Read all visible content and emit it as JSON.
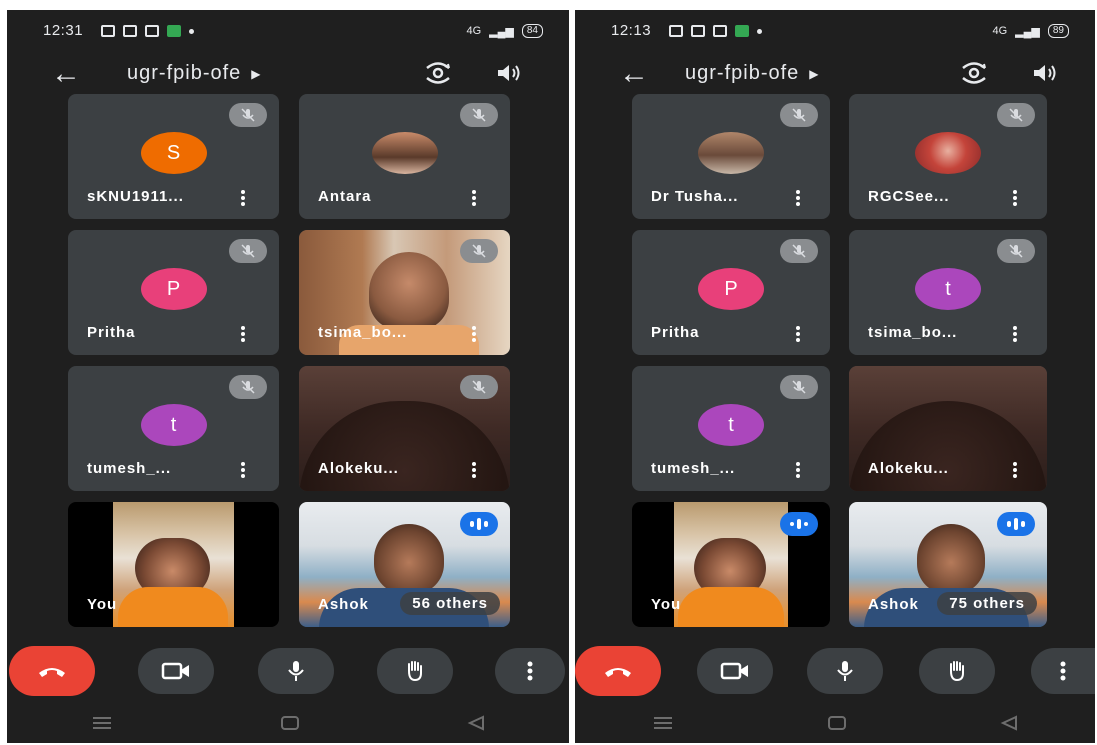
{
  "screens": [
    {
      "status": {
        "time": "12:31",
        "battery": "84",
        "signal_label": "4G"
      },
      "meeting_code": "ugr-fpib-ofe",
      "tiles": [
        {
          "name": "sKNU1911...",
          "initial": "S",
          "avatar_color": "#ef6c00"
        },
        {
          "name": "Antara"
        },
        {
          "name": "Pritha",
          "initial": "P",
          "avatar_color": "#e8407a"
        },
        {
          "name": "tsima_bo..."
        },
        {
          "name": "tumesh_...",
          "initial": "t",
          "avatar_color": "#ab47bc"
        },
        {
          "name": "Alokeku..."
        },
        {
          "name": "You"
        },
        {
          "name": "Ashok"
        }
      ],
      "others_label": "56 others"
    },
    {
      "status": {
        "time": "12:13",
        "battery": "89",
        "signal_label": "4G"
      },
      "meeting_code": "ugr-fpib-ofe",
      "tiles": [
        {
          "name": "Dr Tusha..."
        },
        {
          "name": "RGCSee..."
        },
        {
          "name": "Pritha",
          "initial": "P",
          "avatar_color": "#e8407a"
        },
        {
          "name": "tsima_bo...",
          "initial": "t",
          "avatar_color": "#ab47bc"
        },
        {
          "name": "tumesh_...",
          "initial": "t",
          "avatar_color": "#ab47bc"
        },
        {
          "name": "Alokeku..."
        },
        {
          "name": "You"
        },
        {
          "name": "Ashok"
        }
      ],
      "others_label": "75 others"
    }
  ],
  "colors": {
    "end_call": "#ea4335",
    "speaking": "#1a73e8",
    "tile_bg": "#3c4043",
    "screen_bg": "#1f1f1f"
  },
  "icons": [
    "back-arrow-icon",
    "switch-camera-icon",
    "speaker-icon",
    "mic-off-icon",
    "more-vert-icon",
    "end-call-icon",
    "camera-icon",
    "mic-icon",
    "raise-hand-icon"
  ]
}
